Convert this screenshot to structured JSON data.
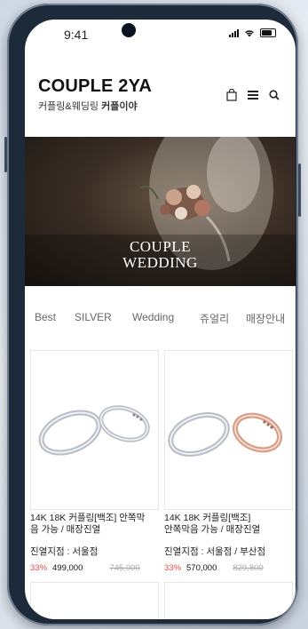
{
  "status": {
    "time": "9:41"
  },
  "header": {
    "title": "COUPLE 2YA",
    "subtitle_plain": "커플링&웨딩링 ",
    "subtitle_bold": "커플이야",
    "icons": [
      "bag-icon",
      "menu-icon",
      "search-icon"
    ]
  },
  "hero": {
    "line1": "COUPLE",
    "line2": "WEDDING"
  },
  "tabs": [
    "Best",
    "SILVER",
    "Wedding",
    "쥬얼리",
    "매장안내"
  ],
  "products": [
    {
      "name_line1": "14K 18K 커플링[백조] 안쪽막",
      "name_line2": "음 가능 / 매장진열",
      "location": "진열지점 : 서울점",
      "discount": "33%",
      "price": "499,000",
      "original": "745,000"
    },
    {
      "name_line1": "14K 18K 커플링[백조]",
      "name_line2": "안쪽막음 가능 / 매장진열",
      "location": "진열지점 : 서울점 / 부산점",
      "discount": "33%",
      "price": "570,000",
      "original": "829,800"
    }
  ],
  "colors": {
    "accent": "#e44c4c",
    "frame": "#1d2a3a"
  }
}
